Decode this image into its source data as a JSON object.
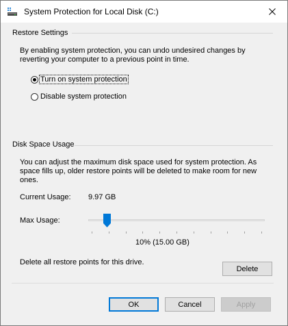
{
  "window": {
    "title": "System Protection for Local Disk (C:)",
    "close_glyph": "✕",
    "icon": "drive-icon"
  },
  "restore_settings": {
    "heading": "Restore Settings",
    "description": "By enabling system protection, you can undo undesired changes by reverting your computer to a previous point in time.",
    "options": [
      {
        "label": "Turn on system protection",
        "selected": true
      },
      {
        "label": "Disable system protection",
        "selected": false
      }
    ]
  },
  "disk_space": {
    "heading": "Disk Space Usage",
    "description": "You can adjust the maximum disk space used for system protection. As space fills up, older restore points will be deleted to make room for new ones.",
    "current_usage_label": "Current Usage:",
    "current_usage_value": "9.97 GB",
    "max_usage_label": "Max Usage:",
    "max_usage_percent": 10,
    "max_usage_value": "10% (15.00 GB)",
    "delete_text": "Delete all restore points for this drive.",
    "delete_button": "Delete"
  },
  "buttons": {
    "ok": "OK",
    "cancel": "Cancel",
    "apply": "Apply"
  },
  "colors": {
    "accent": "#0078d7",
    "window_bg": "#f0f0f0"
  }
}
